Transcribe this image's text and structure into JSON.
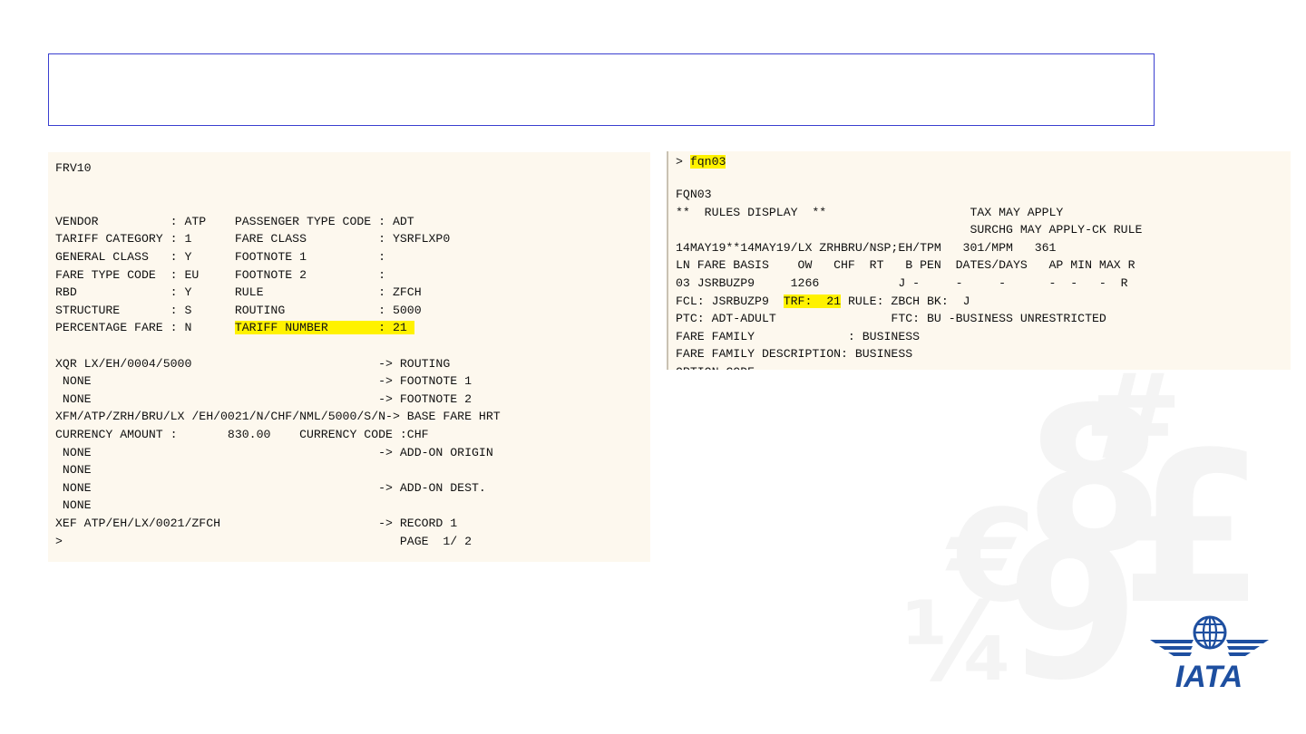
{
  "slide": {
    "title": ""
  },
  "left_terminal": {
    "lines": [
      {
        "text": "FRV10"
      },
      {
        "text": ""
      },
      {
        "text": ""
      },
      {
        "text": "VENDOR          : ATP    PASSENGER TYPE CODE : ADT"
      },
      {
        "text": "TARIFF CATEGORY : 1      FARE CLASS          : YSRFLXP0"
      },
      {
        "text": "GENERAL CLASS   : Y      FOOTNOTE 1          :"
      },
      {
        "text": "FARE TYPE CODE  : EU     FOOTNOTE 2          :"
      },
      {
        "text": "RBD             : Y      RULE                : ZFCH"
      },
      {
        "text": "STRUCTURE       : S      ROUTING             : 5000"
      },
      {
        "pre": "PERCENTAGE FARE : N      ",
        "hl": "TARIFF NUMBER       : 21 ",
        "post": ""
      },
      {
        "text": ""
      },
      {
        "text": "XQR LX/EH/0004/5000                          -> ROUTING"
      },
      {
        "text": " NONE                                        -> FOOTNOTE 1"
      },
      {
        "text": " NONE                                        -> FOOTNOTE 2"
      },
      {
        "text": "XFM/ATP/ZRH/BRU/LX /EH/0021/N/CHF/NML/5000/S/N-> BASE FARE HRT"
      },
      {
        "text": "CURRENCY AMOUNT :       830.00    CURRENCY CODE :CHF"
      },
      {
        "text": " NONE                                        -> ADD-ON ORIGIN"
      },
      {
        "text": " NONE"
      },
      {
        "text": " NONE                                        -> ADD-ON DEST."
      },
      {
        "text": " NONE"
      },
      {
        "text": "XEF ATP/EH/LX/0021/ZFCH                      -> RECORD 1"
      },
      {
        "text": ">                                               PAGE  1/ 2"
      }
    ]
  },
  "right_terminal": {
    "prompt": "> ",
    "command": "fqn03",
    "lines": [
      {
        "text": "FQN03"
      },
      {
        "text": "**  RULES DISPLAY  **                    TAX MAY APPLY"
      },
      {
        "text": "                                         SURCHG MAY APPLY-CK RULE"
      },
      {
        "text": "14MAY19**14MAY19/LX ZRHBRU/NSP;EH/TPM   301/MPM   361"
      },
      {
        "text": "LN FARE BASIS    OW   CHF  RT   B PEN  DATES/DAYS   AP MIN MAX R"
      },
      {
        "text": "03 JSRBUZP9     1266           J -     -     -      -  -   -  R"
      },
      {
        "pre": "FCL: JSRBUZP9  ",
        "hl": "TRF:  21",
        "post": " RULE: ZBCH BK:  J"
      },
      {
        "text": "PTC: ADT-ADULT                FTC: BU -BUSINESS UNRESTRICTED"
      },
      {
        "text": "FARE FAMILY             : BUSINESS"
      },
      {
        "text": "FARE FAMILY DESCRIPTION: BUSINESS"
      },
      {
        "text": "OPTION CODE"
      }
    ]
  },
  "watermark": {
    "glyphs": [
      "€",
      "8",
      "9",
      "£",
      "#",
      "¼"
    ]
  },
  "logo": {
    "text": "IATA",
    "icon": "globe-wings-icon",
    "color": "#1e4fa0"
  }
}
